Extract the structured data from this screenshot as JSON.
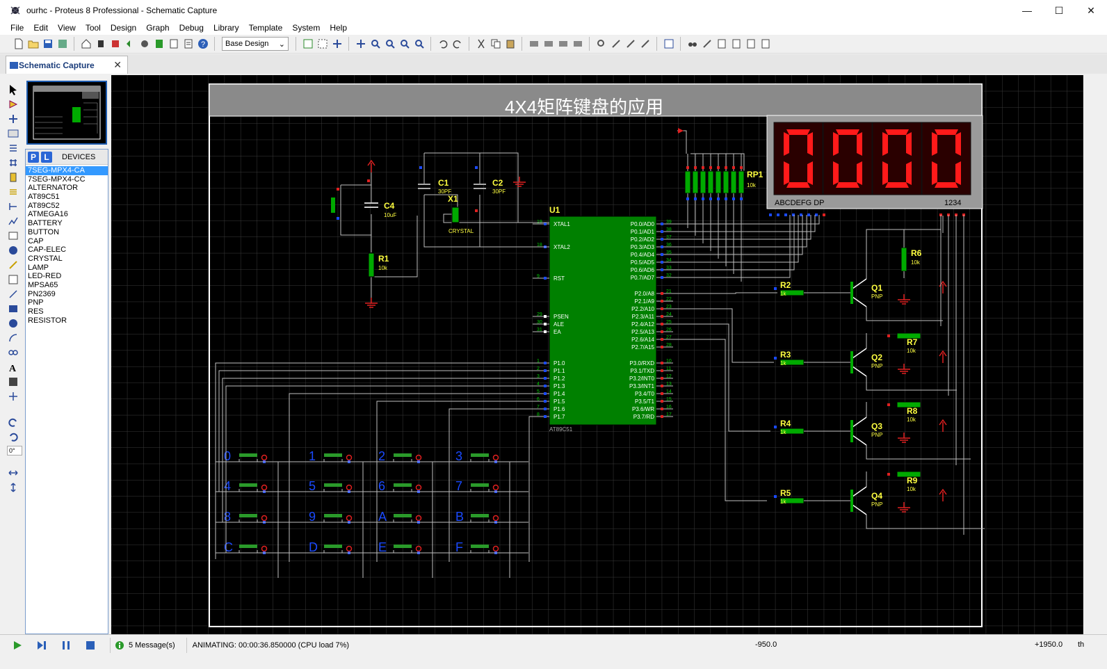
{
  "window": {
    "title": "ourhc - Proteus 8 Professional - Schematic Capture",
    "minimize": "—",
    "maximize": "☐",
    "close": "✕"
  },
  "menu": [
    "File",
    "Edit",
    "View",
    "Tool",
    "Design",
    "Graph",
    "Debug",
    "Library",
    "Template",
    "System",
    "Help"
  ],
  "toolbar": {
    "design_select": "Base Design"
  },
  "tab": {
    "label": "Schematic Capture",
    "close": "✕"
  },
  "left_tools": {
    "rotation": "0°"
  },
  "device_panel": {
    "p_button": "P",
    "l_button": "L",
    "label": "DEVICES",
    "items": [
      "7SEG-MPX4-CA",
      "7SEG-MPX4-CC",
      "ALTERNATOR",
      "AT89C51",
      "AT89C52",
      "ATMEGA16",
      "BATTERY",
      "BUTTON",
      "CAP",
      "CAP-ELEC",
      "CRYSTAL",
      "LAMP",
      "LED-RED",
      "MPSA65",
      "PN2369",
      "PNP",
      "RES",
      "RESISTOR"
    ],
    "selected_index": 0
  },
  "schematic": {
    "title": "4X4矩阵键盘的应用",
    "display": {
      "digits": "0000",
      "seg_label": "ABCDEFG DP",
      "digit_label": "1234"
    },
    "mcu": {
      "ref": "U1",
      "part": "AT89C51",
      "left_pins": [
        {
          "num": "19",
          "name": "XTAL1"
        },
        {
          "num": "18",
          "name": "XTAL2"
        },
        {
          "num": "9",
          "name": "RST"
        },
        {
          "num": "29",
          "name": "PSEN"
        },
        {
          "num": "30",
          "name": "ALE"
        },
        {
          "num": "31",
          "name": "EA"
        },
        {
          "num": "1",
          "name": "P1.0"
        },
        {
          "num": "2",
          "name": "P1.1"
        },
        {
          "num": "3",
          "name": "P1.2"
        },
        {
          "num": "4",
          "name": "P1.3"
        },
        {
          "num": "5",
          "name": "P1.4"
        },
        {
          "num": "6",
          "name": "P1.5"
        },
        {
          "num": "7",
          "name": "P1.6"
        },
        {
          "num": "8",
          "name": "P1.7"
        }
      ],
      "right_pins": [
        {
          "num": "39",
          "name": "P0.0/AD0"
        },
        {
          "num": "38",
          "name": "P0.1/AD1"
        },
        {
          "num": "37",
          "name": "P0.2/AD2"
        },
        {
          "num": "36",
          "name": "P0.3/AD3"
        },
        {
          "num": "35",
          "name": "P0.4/AD4"
        },
        {
          "num": "34",
          "name": "P0.5/AD5"
        },
        {
          "num": "33",
          "name": "P0.6/AD6"
        },
        {
          "num": "32",
          "name": "P0.7/AD7"
        },
        {
          "num": "21",
          "name": "P2.0/A8"
        },
        {
          "num": "22",
          "name": "P2.1/A9"
        },
        {
          "num": "23",
          "name": "P2.2/A10"
        },
        {
          "num": "24",
          "name": "P2.3/A11"
        },
        {
          "num": "25",
          "name": "P2.4/A12"
        },
        {
          "num": "26",
          "name": "P2.5/A13"
        },
        {
          "num": "27",
          "name": "P2.6/A14"
        },
        {
          "num": "28",
          "name": "P2.7/A15"
        },
        {
          "num": "10",
          "name": "P3.0/RXD"
        },
        {
          "num": "11",
          "name": "P3.1/TXD"
        },
        {
          "num": "12",
          "name": "P3.2/INT0"
        },
        {
          "num": "13",
          "name": "P3.3/INT1"
        },
        {
          "num": "14",
          "name": "P3.4/T0"
        },
        {
          "num": "15",
          "name": "P3.5/T1"
        },
        {
          "num": "16",
          "name": "P3.6/WR"
        },
        {
          "num": "17",
          "name": "P3.7/RD"
        }
      ]
    },
    "passives": {
      "c1": {
        "ref": "C1",
        "value": "30PF"
      },
      "c2": {
        "ref": "C2",
        "value": "30PF"
      },
      "c4": {
        "ref": "C4",
        "value": "10uF"
      },
      "x1": {
        "ref": "X1",
        "value": "CRYSTAL"
      },
      "r1": {
        "ref": "R1",
        "value": "10k"
      },
      "rp": {
        "ref": "RP1",
        "value": "10k"
      },
      "r2": {
        "ref": "R2",
        "value": "1k"
      },
      "r3": {
        "ref": "R3",
        "value": "1k"
      },
      "r4": {
        "ref": "R4",
        "value": "1k"
      },
      "r5": {
        "ref": "R5",
        "value": "1k"
      },
      "r6": {
        "ref": "R6",
        "value": "10k"
      },
      "r7": {
        "ref": "R7",
        "value": "10k"
      },
      "r8": {
        "ref": "R8",
        "value": "10k"
      },
      "r9": {
        "ref": "R9",
        "value": "10k"
      }
    },
    "transistors": [
      {
        "ref": "Q1",
        "type": "PNP"
      },
      {
        "ref": "Q2",
        "type": "PNP"
      },
      {
        "ref": "Q3",
        "type": "PNP"
      },
      {
        "ref": "Q4",
        "type": "PNP"
      }
    ],
    "keys": [
      "0",
      "1",
      "2",
      "3",
      "4",
      "5",
      "6",
      "7",
      "8",
      "9",
      "A",
      "B",
      "C",
      "D",
      "E",
      "F"
    ]
  },
  "status": {
    "messages": "5 Message(s)",
    "animating": "ANIMATING: 00:00:36.850000 (CPU load 7%)",
    "coord_x": "-950.0",
    "coord_y": "+1950.0",
    "unit": "th"
  },
  "colors": {
    "canvas_bg": "#000000",
    "grid": "#3a3a3a",
    "wire": "#c0c0c0",
    "mcu_fill": "#008000",
    "seg_on": "#ff1a1a",
    "label_yellow": "#ffff40",
    "tab_text": "#1a3c7a",
    "selected_bg": "#3399ff"
  }
}
